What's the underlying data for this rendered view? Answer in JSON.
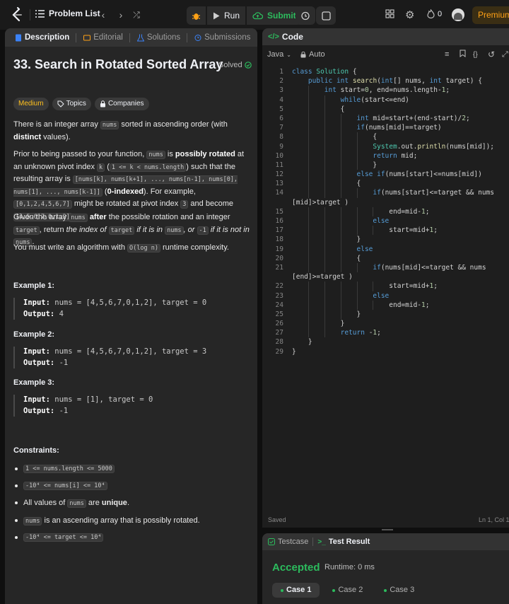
{
  "nav": {
    "problem_list": "Problem List",
    "run": "Run",
    "submit": "Submit",
    "streak": "0",
    "premium": "Premium"
  },
  "left_tabs": [
    "Description",
    "Editorial",
    "Solutions",
    "Submissions"
  ],
  "problem": {
    "title": "33. Search in Rotated Sorted Array",
    "solved": "Solved",
    "difficulty": "Medium",
    "topics": "Topics",
    "companies": "Companies"
  },
  "examples": [
    {
      "title": "Example 1:",
      "input_label": "Input:",
      "input": " nums = [4,5,6,7,0,1,2], target = 0",
      "output_label": "Output:",
      "output": " 4"
    },
    {
      "title": "Example 2:",
      "input_label": "Input:",
      "input": " nums = [4,5,6,7,0,1,2], target = 3",
      "output_label": "Output:",
      "output": " -1"
    },
    {
      "title": "Example 3:",
      "input_label": "Input:",
      "input": " nums = [1], target = 0",
      "output_label": "Output:",
      "output": " -1"
    }
  ],
  "constraints_title": "Constraints:",
  "code_panel": {
    "title": "Code",
    "language": "Java",
    "mode": "Auto",
    "status_left": "Saved",
    "status_right": "Ln 1, Col 1"
  },
  "code_lines": [
    "class Solution {",
    "    public int search(int[] nums, int target) {",
    "        int start=0, end=nums.length-1;",
    "            while(start<=end)",
    "            {",
    "                int mid=start+(end-start)/2;",
    "                if(nums[mid]==target)",
    "                    {",
    "                    System.out.println(nums[mid]);",
    "                    return mid;",
    "                    }",
    "                else if(nums[start]<=nums[mid])",
    "                {",
    "                    if(nums[start]<=target && nums",
    "[mid]>target )",
    "                        end=mid-1;",
    "                    else",
    "                        start=mid+1;",
    "                }",
    "                else",
    "                {",
    "                    if(nums[mid]<=target && nums",
    "[end]>=target )",
    "                        start=mid+1;",
    "                    else",
    "                        end=mid-1;",
    "                }",
    "            }",
    "            return -1;",
    "    }",
    "}"
  ],
  "line_numbers": [
    "1",
    "2",
    "3",
    "4",
    "5",
    "6",
    "7",
    "8",
    "9",
    "10",
    "11",
    "12",
    "13",
    "14",
    "",
    "15",
    "16",
    "17",
    "18",
    "19",
    "20",
    "21",
    "",
    "22",
    "23",
    "24",
    "25",
    "26",
    "27",
    "28",
    "29"
  ],
  "result_panel": {
    "tab_testcase": "Testcase",
    "tab_result": "Test Result",
    "status": "Accepted",
    "runtime": "Runtime: 0 ms",
    "cases": [
      "Case 1",
      "Case 2",
      "Case 3"
    ]
  },
  "colors": {
    "accent": "#ffa116",
    "accepted": "#2cbb5d",
    "medium": "#ffc01e"
  }
}
